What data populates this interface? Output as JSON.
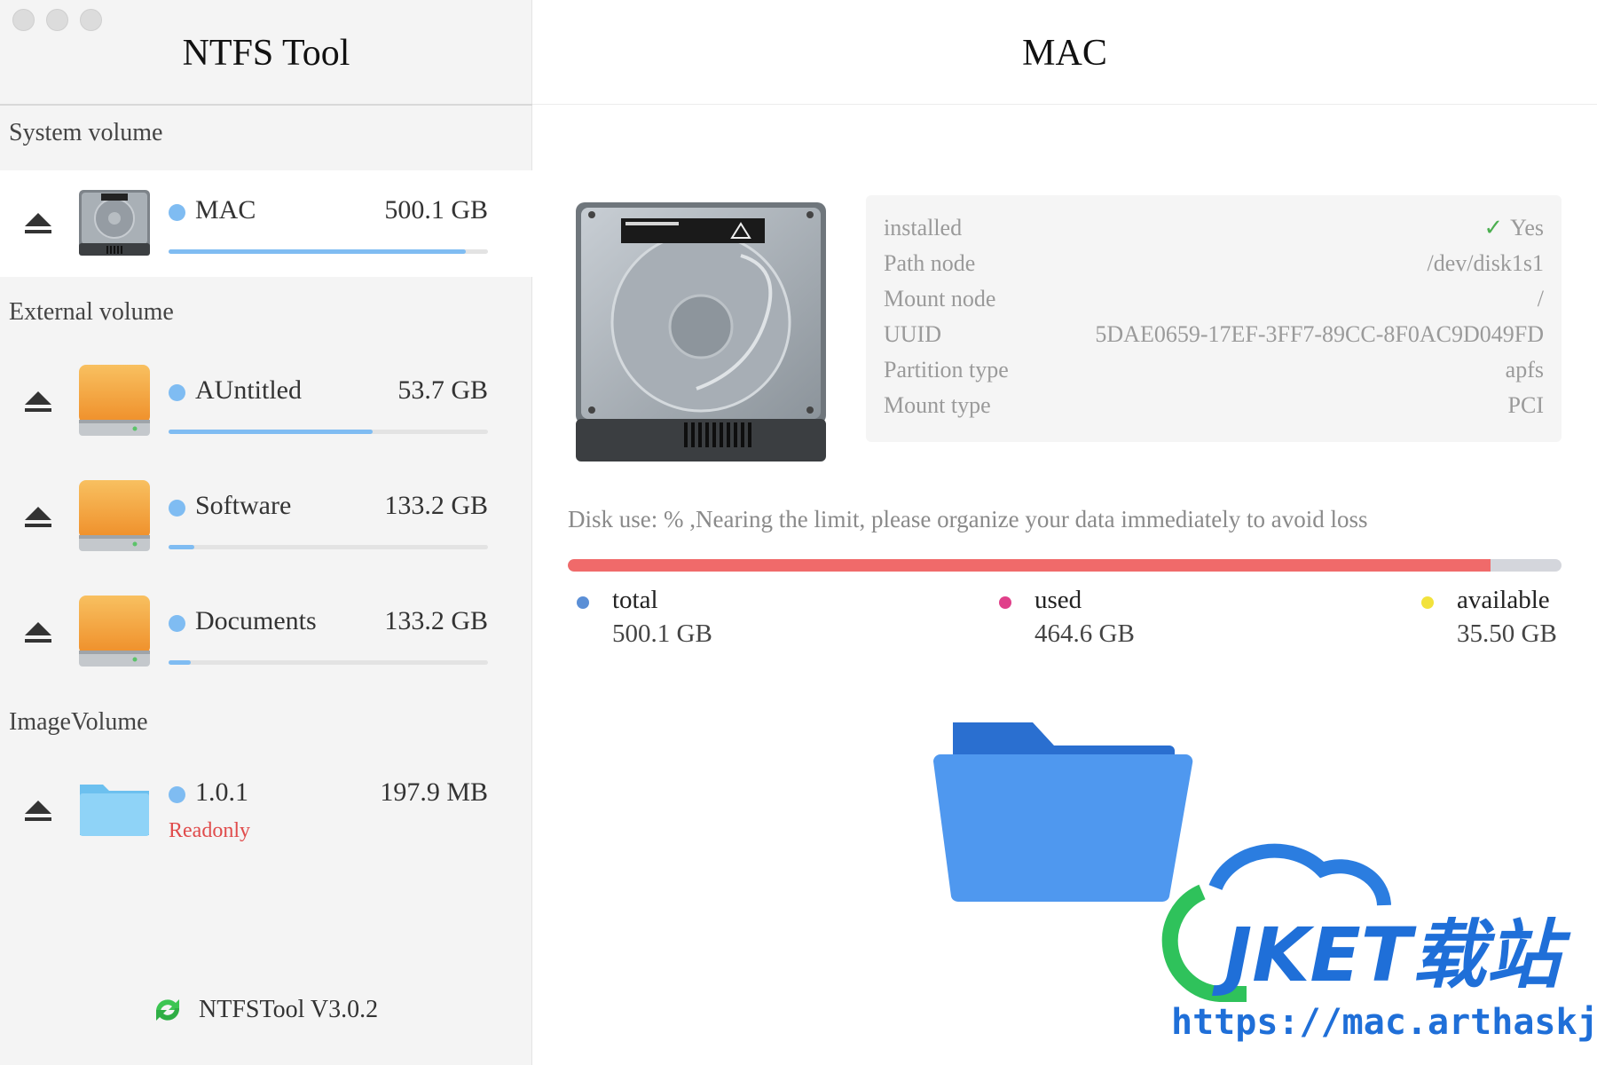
{
  "sidebar": {
    "app_title": "NTFS Tool",
    "sections": {
      "system": "System volume",
      "external": "External volume",
      "image": "ImageVolume"
    },
    "volumes": [
      {
        "name": "MAC",
        "size": "500.1 GB",
        "usage": 0.93,
        "icon": "hard-disk-icon"
      },
      {
        "name": "AUntitled",
        "size": "53.7 GB",
        "usage": 0.64,
        "icon": "external-drive-icon"
      },
      {
        "name": "Software",
        "size": "133.2 GB",
        "usage": 0.08,
        "icon": "external-drive-icon"
      },
      {
        "name": "Documents",
        "size": "133.2 GB",
        "usage": 0.07,
        "icon": "external-drive-icon"
      },
      {
        "name": "1.0.1",
        "size": "197.9 MB",
        "status": "Readonly",
        "icon": "folder-icon"
      }
    ],
    "footer_version": "NTFSTool V3.0.2",
    "accent": "#7fbcf2"
  },
  "main": {
    "title": "MAC",
    "info": [
      {
        "key": "installed",
        "value": "Yes"
      },
      {
        "key": "Path node",
        "value": "/dev/disk1s1"
      },
      {
        "key": "Mount node",
        "value": "/"
      },
      {
        "key": "UUID",
        "value": "5DAE0659-17EF-3FF7-89CC-8F0AC9D049FD"
      },
      {
        "key": "Partition type",
        "value": "apfs"
      },
      {
        "key": "Mount type",
        "value": "PCI"
      }
    ],
    "disk_use_text": "Disk use: % ,Nearing the limit, please organize your data immediately to avoid loss",
    "disk_use_fraction": 0.929,
    "legend": [
      {
        "label": "total",
        "value": "500.1 GB",
        "color": "#5b8fd6"
      },
      {
        "label": "used",
        "value": "464.6 GB",
        "color": "#e0408a"
      },
      {
        "label": "available",
        "value": "35.50 GB",
        "color": "#f2e23c"
      }
    ],
    "usage_color": "#f06a6a"
  },
  "watermark": {
    "brand": "JKET载站",
    "url": "https://mac.arthaskj.top"
  }
}
